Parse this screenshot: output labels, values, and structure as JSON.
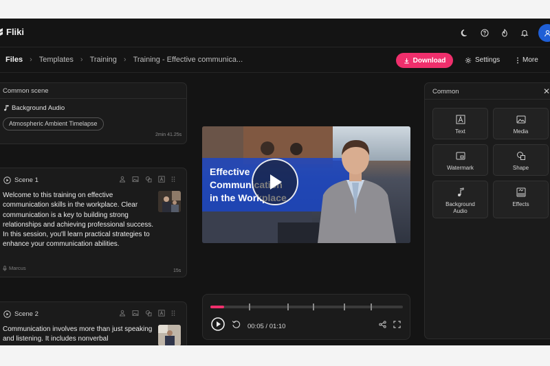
{
  "app": {
    "name": "Fliki"
  },
  "topbar": {
    "icons": [
      "moon-icon",
      "help-icon",
      "flame-icon",
      "bell-icon",
      "user-icon"
    ]
  },
  "breadcrumb": {
    "items": [
      "Files",
      "Templates",
      "Training",
      "Training - Effective communica..."
    ]
  },
  "actions": {
    "download_label": "Download",
    "settings_label": "Settings",
    "more_label": "More"
  },
  "common_scene": {
    "title": "Common scene",
    "audio_label": "Background Audio",
    "audio_track": "Atmospheric Ambient Timelapse",
    "duration": "2min 41.25s"
  },
  "scenes": [
    {
      "label": "Scene 1",
      "text": "Welcome to this training on effective communication skills in the workplace. Clear communication is a key to building strong relationships and achieving professional success. In this session, you'll learn practical strategies to enhance your communication abilities.",
      "voice": "Marcus",
      "duration": "15s"
    },
    {
      "label": "Scene 2",
      "text": "Communication involves more than just speaking and listening. It includes nonverbal"
    }
  ],
  "video": {
    "title_line1": "Effective",
    "title_line2": "Communication",
    "title_line3": "in the Workplace"
  },
  "player": {
    "time": "00:05 / 01:10",
    "progress": 0.07
  },
  "panel": {
    "title": "Common",
    "tiles": [
      "Text",
      "Media",
      "Watermark",
      "Shape",
      "Background Audio",
      "Effects"
    ]
  },
  "colors": {
    "accent": "#ef2f6c",
    "background": "#141414",
    "avatar": "#1f5fd6"
  }
}
